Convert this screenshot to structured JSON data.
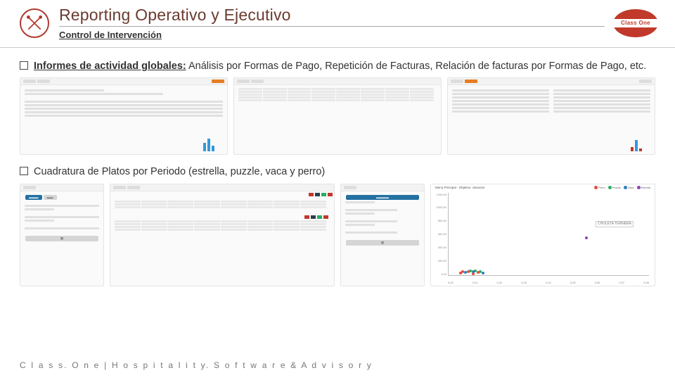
{
  "header": {
    "title": "Reporting Operativo y Ejecutivo",
    "subtitle": "Control de Intervención",
    "brand": "Class One"
  },
  "bullets": {
    "b1_strong": "Informes de actividad globales:",
    "b1_rest": " Análisis por Formas de Pago, Repetición de Facturas, Relación de facturas por Formas de Pago, etc.",
    "b2": "Cuadratura de Platos por Periodo (estrella, puzzle, vaca y perro)"
  },
  "scatter": {
    "title": "Menú Principal",
    "subtitle": "Objetivo: classone",
    "annotation": "CHULETA TERNERA",
    "legend": [
      "Perro",
      "Puzzle",
      "Vaca",
      "Estrella"
    ],
    "legend_colors": [
      "#e74c3c",
      "#27ae60",
      "#2980b9",
      "#8e44ad"
    ],
    "yticks": [
      "1200,00",
      "1000,00",
      "800,00",
      "600,00",
      "400,00",
      "200,00",
      "0,00"
    ],
    "xticks": [
      "0,00",
      "0,01",
      "0,02",
      "0,03",
      "0,04",
      "0,05",
      "0,06",
      "0,07",
      "0,08"
    ]
  },
  "chart_data": {
    "type": "scatter",
    "title": "Cuadratura de Platos por Periodo",
    "xlabel": "",
    "ylabel": "",
    "xlim": [
      0.0,
      0.08
    ],
    "ylim": [
      0,
      1200
    ],
    "series": [
      {
        "name": "Perro",
        "color": "#e74c3c",
        "points": [
          [
            0.005,
            40
          ],
          [
            0.008,
            55
          ],
          [
            0.01,
            30
          ],
          [
            0.012,
            48
          ],
          [
            0.006,
            60
          ]
        ]
      },
      {
        "name": "Puzzle",
        "color": "#27ae60",
        "points": [
          [
            0.009,
            70
          ],
          [
            0.011,
            65
          ],
          [
            0.013,
            58
          ]
        ]
      },
      {
        "name": "Vaca",
        "color": "#2980b9",
        "points": [
          [
            0.007,
            45
          ],
          [
            0.01,
            52
          ],
          [
            0.014,
            40
          ]
        ]
      },
      {
        "name": "Estrella",
        "color": "#8e44ad",
        "points": [
          [
            0.055,
            540
          ]
        ]
      }
    ],
    "annotations": [
      {
        "text": "CHULETA TERNERA",
        "x": 0.055,
        "y": 540
      }
    ]
  },
  "footer": "C l a s s. O n e | H o s p i t a l i t y. S o f t w a r e & A d v i s o r y"
}
